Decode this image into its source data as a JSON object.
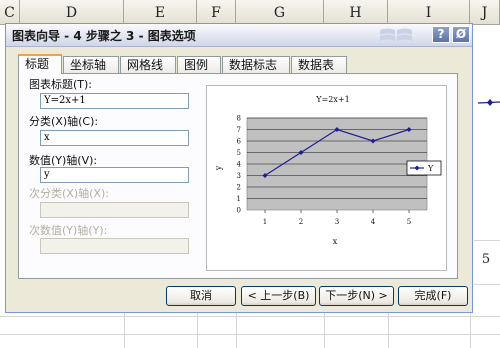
{
  "spreadsheet": {
    "columns": [
      "C",
      "D",
      "E",
      "F",
      "G",
      "H",
      "I",
      "J"
    ],
    "cell_value": "5"
  },
  "dialog": {
    "title": "图表向导 - 4 步骤之 3 - 图表选项",
    "help_button": "?",
    "close_button": "Ø",
    "tabs": [
      "标题",
      "坐标轴",
      "网格线",
      "图例",
      "数据标志",
      "数据表"
    ],
    "fields": {
      "chart_title_label": "图表标题(T):",
      "chart_title_value": "Y=2x+1",
      "category_x_label": "分类(X)轴(C):",
      "category_x_value": "x",
      "value_y_label": "数值(Y)轴(V):",
      "value_y_value": "y",
      "secondary_category_label": "次分类(X)轴(X):",
      "secondary_value_label": "次数值(Y)轴(Y):"
    },
    "buttons": {
      "cancel": "取消",
      "back": "< 上一步(B)",
      "next": "下一步(N) >",
      "finish": "完成(F)"
    }
  },
  "chart_data": {
    "type": "line",
    "title": "Y=2x+1",
    "xlabel": "x",
    "ylabel": "y",
    "categories": [
      "1",
      "2",
      "3",
      "4",
      "5"
    ],
    "ylim": [
      0,
      8
    ],
    "yticks": [
      "0",
      "1",
      "2",
      "3",
      "4",
      "5",
      "6",
      "7",
      "8"
    ],
    "series": [
      {
        "name": "Y",
        "values": [
          3,
          5,
          7,
          6,
          7
        ]
      }
    ],
    "grid": true,
    "legend": "right",
    "colors": {
      "series": "#1f1f8f",
      "plot_bg": "#c0c0c0"
    }
  }
}
